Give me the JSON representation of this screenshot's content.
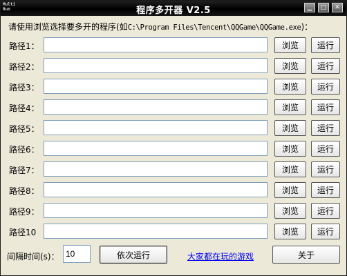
{
  "window": {
    "title": "程序多开器 V2.5",
    "icon_text_1": "Multi",
    "icon_text_2": "Run",
    "controls": {
      "minimize": "▁",
      "maximize": "□",
      "close": "✕"
    }
  },
  "instruction": {
    "prefix": "请使用浏览选择要多开的程序(如",
    "path": "C:\\Program Files\\Tencent\\QQGame\\QQGame.exe",
    "suffix": ")："
  },
  "rows": [
    {
      "label": "路径1：",
      "value": ""
    },
    {
      "label": "路径2：",
      "value": ""
    },
    {
      "label": "路径3：",
      "value": ""
    },
    {
      "label": "路径4：",
      "value": ""
    },
    {
      "label": "路径5：",
      "value": ""
    },
    {
      "label": "路径6：",
      "value": ""
    },
    {
      "label": "路径7：",
      "value": ""
    },
    {
      "label": "路径8：",
      "value": ""
    },
    {
      "label": "路径9：",
      "value": ""
    },
    {
      "label": "路径10",
      "value": ""
    }
  ],
  "buttons": {
    "browse": "浏览",
    "run": "运行",
    "sequential_run": "依次运行",
    "about": "关于"
  },
  "interval": {
    "label": "间隔时间(s)：",
    "value": "10"
  },
  "link": {
    "text": "大家都在玩的游戏"
  }
}
